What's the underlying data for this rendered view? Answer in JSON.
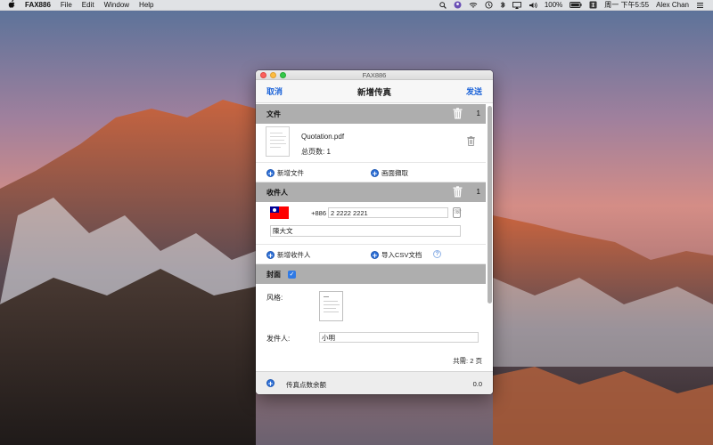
{
  "menubar": {
    "app_name": "FAX886",
    "menus": [
      "File",
      "Edit",
      "Window",
      "Help"
    ],
    "battery": "100%",
    "clock": "周一 下午5:55",
    "user": "Alex Chan"
  },
  "window": {
    "title": "FAX886",
    "cancel": "取消",
    "heading": "新增传真",
    "send": "发送"
  },
  "files_section": {
    "title": "文件",
    "count": "1",
    "file_name": "Quotation.pdf",
    "total_pages": "总页数: 1",
    "add_file": "新增文件",
    "screen_capture": "画面擷取"
  },
  "recipients_section": {
    "title": "收件人",
    "count": "1",
    "country_code": "+886",
    "phone": "2 2222 2221",
    "name": "陳大文",
    "add_recipient": "新增收件人",
    "import_csv": "导入CSV文档",
    "help": "?"
  },
  "cover_section": {
    "title": "封面",
    "checked": true,
    "check_mark": "✓",
    "style_label": "风格:",
    "sender_label": "发件人:",
    "sender_value": "小明"
  },
  "summary": {
    "total_pages": "共需: 2 页",
    "credit_label": "传真点数余额",
    "credit_value": "0.0"
  },
  "colors": {
    "accent": "#1a62d8",
    "section_header": "#aeaeae"
  }
}
